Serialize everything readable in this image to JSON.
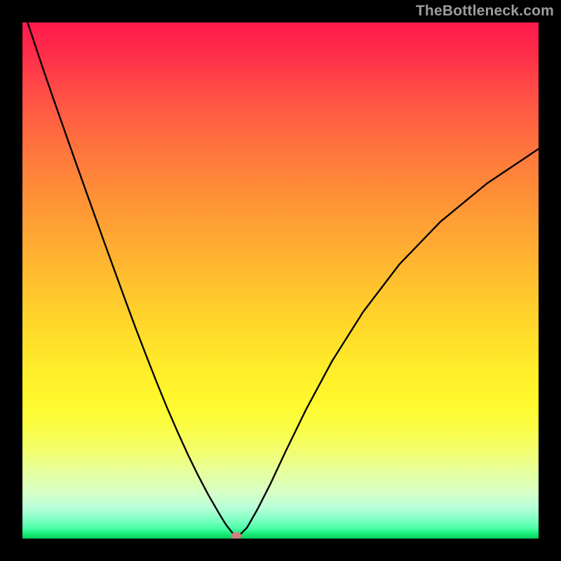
{
  "watermark": "TheBottleneck.com",
  "colors": {
    "marker": "#d08080",
    "curve": "#000000"
  },
  "chart_data": {
    "type": "line",
    "title": "",
    "xlabel": "",
    "ylabel": "",
    "xlim": [
      0,
      100
    ],
    "ylim": [
      0,
      100
    ],
    "grid": false,
    "legend": false,
    "series": [
      {
        "name": "bottleneck-curve",
        "x": [
          0,
          2,
          4,
          6,
          8,
          10,
          12,
          14,
          16,
          18,
          20,
          22,
          24,
          26,
          28,
          30,
          32,
          34,
          36,
          37.5,
          38.5,
          39.5,
          41,
          42,
          43.5,
          45.5,
          48,
          51,
          55,
          60,
          66,
          73,
          81,
          90,
          100
        ],
        "y": [
          103,
          97,
          91,
          85.2,
          79.5,
          73.8,
          68.2,
          62.6,
          57,
          51.5,
          46,
          40.6,
          35.4,
          30.3,
          25.4,
          20.8,
          16.4,
          12.3,
          8.5,
          5.9,
          4.2,
          2.6,
          0.7,
          0.6,
          2.1,
          5.6,
          10.5,
          16.9,
          25.1,
          34.4,
          43.9,
          53.1,
          61.4,
          68.8,
          75.5
        ]
      }
    ],
    "marker": {
      "x": 41.5,
      "y": 0.5
    },
    "background_gradient": {
      "top": "#ff1a4d",
      "mid": "#ffec2a",
      "bottom": "#07c95e"
    }
  }
}
